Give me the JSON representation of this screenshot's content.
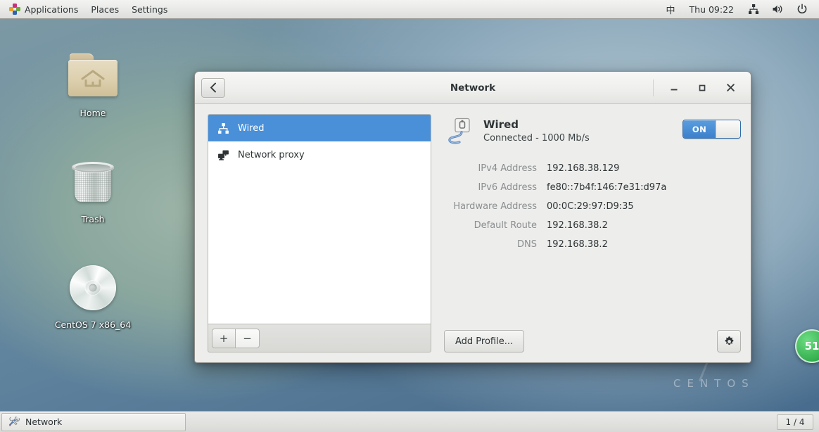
{
  "top_panel": {
    "menus": [
      {
        "label": "Applications",
        "icon": "applications-logo-icon"
      },
      {
        "label": "Places",
        "icon": ""
      },
      {
        "label": "Settings",
        "icon": ""
      }
    ],
    "tray": {
      "ime_label": "中",
      "clock": "Thu 09:22",
      "network_icon": "network-tray-icon",
      "volume_icon": "volume-tray-icon",
      "power_icon": "power-tray-icon"
    }
  },
  "desktop": {
    "icons": [
      {
        "label": "Home",
        "icon": "home-folder-icon"
      },
      {
        "label": "Trash",
        "icon": "trash-icon"
      },
      {
        "label": "CentOS 7 x86_64",
        "icon": "optical-disc-icon"
      }
    ],
    "watermark": "CENTOS",
    "edge_badge": "51"
  },
  "window": {
    "title": "Network",
    "back_icon": "chevron-left-icon",
    "controls": {
      "minimize": "minimize-icon",
      "maximize": "maximize-icon",
      "close": "close-icon"
    },
    "sidebar": {
      "items": [
        {
          "label": "Wired",
          "icon": "network-wired-icon",
          "selected": true
        },
        {
          "label": "Network proxy",
          "icon": "network-proxy-icon",
          "selected": false
        }
      ],
      "add_label": "+",
      "remove_label": "−"
    },
    "detail": {
      "connection_name": "Wired",
      "connection_status": "Connected - 1000 Mb/s",
      "connection_icon": "ethernet-cable-icon",
      "toggle_label": "ON",
      "toggle_state": "on",
      "accent_color": "#4a90d9",
      "rows": [
        {
          "label": "IPv4 Address",
          "value": "192.168.38.129"
        },
        {
          "label": "IPv6 Address",
          "value": "fe80::7b4f:146:7e31:d97a"
        },
        {
          "label": "Hardware Address",
          "value": "00:0C:29:97:D9:35"
        },
        {
          "label": "Default Route",
          "value": "192.168.38.2"
        },
        {
          "label": "DNS",
          "value": "192.168.38.2"
        }
      ],
      "add_profile_label": "Add Profile...",
      "settings_icon": "gear-icon"
    }
  },
  "taskbar": {
    "window_button": {
      "label": "Network",
      "icon": "preferences-tools-icon"
    },
    "workspace": "1 / 4"
  }
}
